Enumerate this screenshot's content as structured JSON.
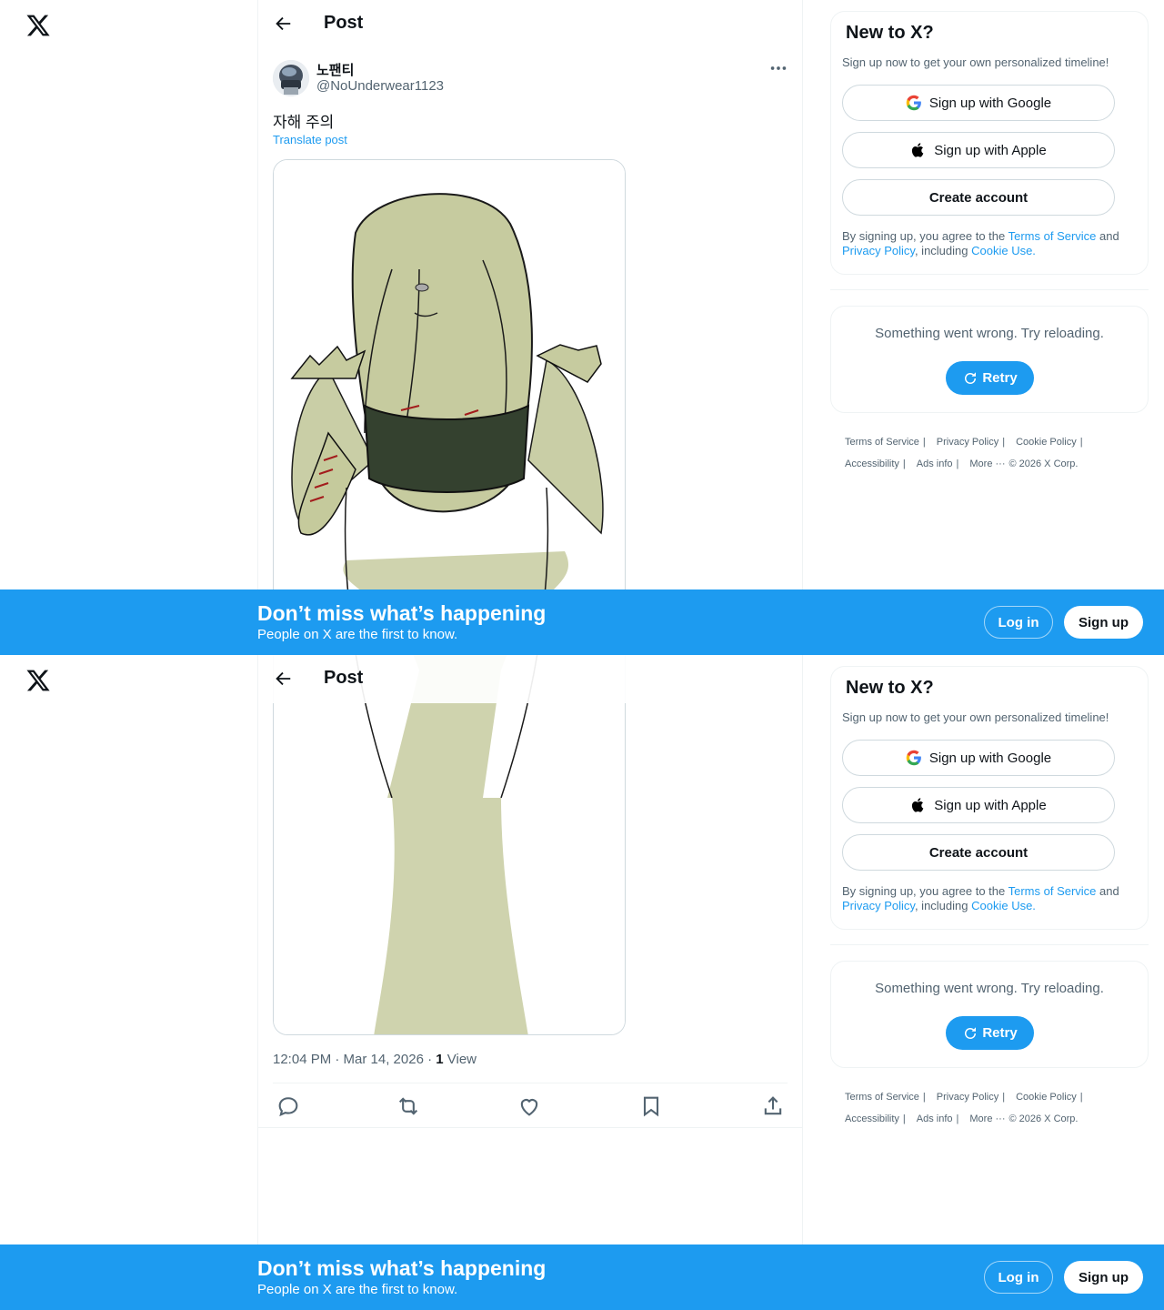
{
  "header": {
    "title": "Post"
  },
  "post": {
    "display_name": "노팬티",
    "handle": "@NoUnderwear1123",
    "text": "자해 주의",
    "translate_label": "Translate post",
    "time": "12:04 PM · Mar 14, 2026 · ",
    "views_count": "1",
    "views_label": " View"
  },
  "actions": [
    {
      "icon": "reply-icon"
    },
    {
      "icon": "repost-icon"
    },
    {
      "icon": "like-icon"
    },
    {
      "icon": "bookmark-icon"
    },
    {
      "icon": "share-icon"
    }
  ],
  "signup": {
    "title": "New to X?",
    "subtitle": "Sign up now to get your own personalized timeline!",
    "google": "Sign up with Google",
    "apple": "Sign up with Apple",
    "create": "Create account",
    "terms_pre": "By signing up, you agree to the ",
    "terms_tos": "Terms of Service",
    "terms_and": " and ",
    "terms_privacy": "Privacy Policy",
    "terms_including": ", including ",
    "terms_cookie": "Cookie Use."
  },
  "error": {
    "text": "Something went wrong. Try reloading.",
    "retry": "Retry"
  },
  "footer": {
    "tos": "Terms of Service",
    "privacy": "Privacy Policy",
    "cookie": "Cookie Policy",
    "accessibility": "Accessibility",
    "ads": "Ads info",
    "more": "More ···",
    "copyright": "© 2026 X Corp."
  },
  "banner": {
    "title": "Don’t miss what’s happening",
    "subtitle": "People on X are the first to know.",
    "login": "Log in",
    "signup": "Sign up"
  },
  "colors": {
    "accent": "#1d9bf0",
    "text": "#0f1419",
    "muted": "#536471",
    "border": "#eff3f4"
  }
}
